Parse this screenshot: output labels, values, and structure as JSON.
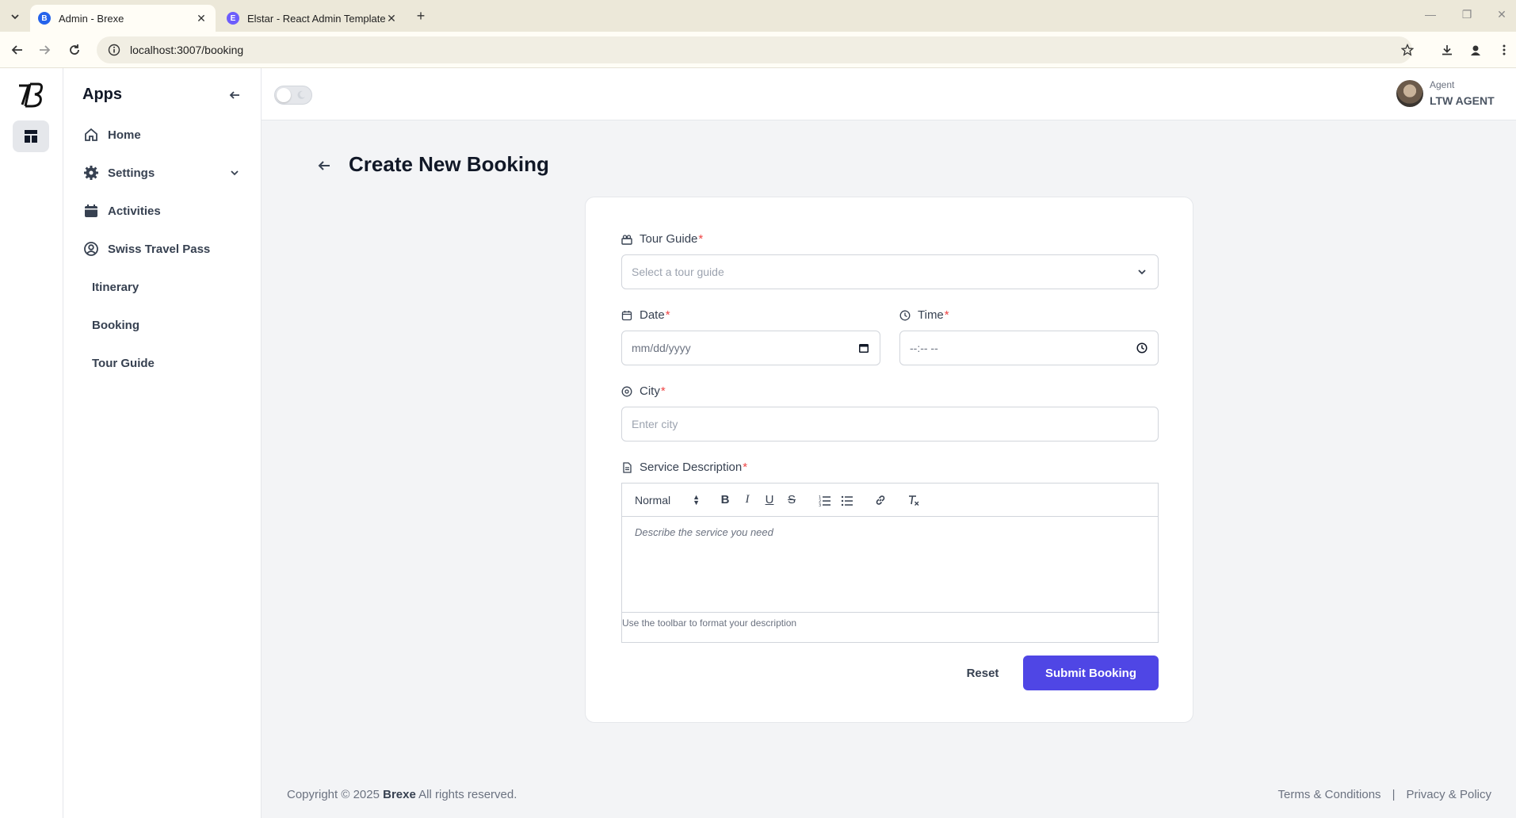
{
  "browser": {
    "tabs": [
      {
        "title": "Admin - Brexe",
        "active": true
      },
      {
        "title": "Elstar - React Admin Template",
        "active": false
      }
    ],
    "url": "localhost:3007/booking"
  },
  "sidebar": {
    "title": "Apps",
    "items": [
      {
        "label": "Home",
        "icon": "home-icon"
      },
      {
        "label": "Settings",
        "icon": "gear-icon"
      },
      {
        "label": "Activities",
        "icon": "calendar-icon"
      },
      {
        "label": "Swiss Travel Pass",
        "icon": "user-circle-icon"
      },
      {
        "label": "Itinerary"
      },
      {
        "label": "Booking"
      },
      {
        "label": "Tour Guide"
      }
    ]
  },
  "header": {
    "user_role": "Agent",
    "user_name": "LTW AGENT"
  },
  "page": {
    "title": "Create New Booking"
  },
  "form": {
    "tour_guide": {
      "label": "Tour Guide",
      "required": "*",
      "placeholder": "Select a tour guide"
    },
    "date": {
      "label": "Date",
      "required": "*",
      "placeholder": "mm/dd/yyyy"
    },
    "time": {
      "label": "Time",
      "required": "*",
      "placeholder": "--:-- --"
    },
    "city": {
      "label": "City",
      "required": "*",
      "placeholder": "Enter city"
    },
    "description": {
      "label": "Service Description",
      "required": "*",
      "format_value": "Normal",
      "placeholder": "Describe the service you need",
      "help": "Use the toolbar to format your description"
    },
    "reset_label": "Reset",
    "submit_label": "Submit Booking"
  },
  "footer": {
    "copyright_prefix": "Copyright © 2025",
    "brand": "Brexe",
    "copyright_suffix": "All rights reserved.",
    "terms": "Terms & Conditions",
    "separator": "|",
    "privacy": "Privacy & Policy"
  },
  "colors": {
    "primary": "#4f46e5",
    "required": "#ef4444"
  }
}
